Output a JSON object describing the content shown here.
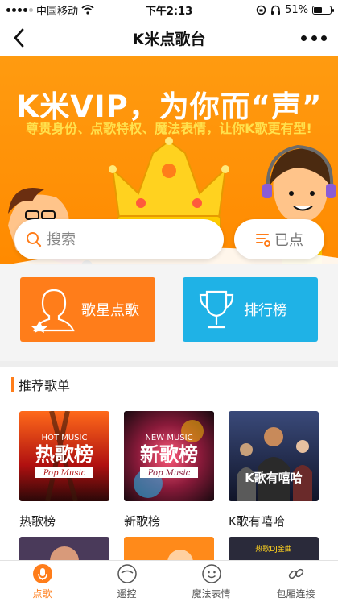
{
  "status_bar": {
    "carrier": "中国移动",
    "time": "下午2:13",
    "battery": "51%",
    "battery_level": 0.51
  },
  "nav": {
    "title": "K米点歌台"
  },
  "banner": {
    "headline": "K米VIP，为你而“声”",
    "subline": "尊贵身份、点歌特权、魔法表情，让你K歌更有型!"
  },
  "search": {
    "placeholder": "搜索",
    "played_label": "已点"
  },
  "features": [
    {
      "label": "歌星点歌",
      "icon": "singer-icon",
      "color": "#ff7d1a"
    },
    {
      "label": "排行榜",
      "icon": "trophy-icon",
      "color": "#1fb2e6"
    }
  ],
  "recommend": {
    "heading": "推荐歌单",
    "playlists": [
      {
        "title": "热歌榜",
        "art_top": "HOT MUSIC",
        "art_main": "热歌榜",
        "art_sub": "Pop Music"
      },
      {
        "title": "新歌榜",
        "art_top": "NEW MUSIC",
        "art_main": "新歌榜",
        "art_sub": "Pop Music"
      },
      {
        "title": "K歌有嘻哈",
        "art_main": "K歌有嘻哈"
      }
    ],
    "partial_tiles": [
      {
        "art_text": ""
      },
      {
        "art_text": ""
      },
      {
        "art_text": "热歌DJ金曲"
      }
    ]
  },
  "tabs": [
    {
      "label": "点歌",
      "icon": "microphone-icon",
      "active": true
    },
    {
      "label": "遥控",
      "icon": "remote-icon",
      "active": false
    },
    {
      "label": "魔法表情",
      "icon": "smile-icon",
      "active": false
    },
    {
      "label": "包厢连接",
      "icon": "link-icon",
      "active": false
    }
  ],
  "colors": {
    "accent": "#ff7d1a",
    "banner": "#ff9b10",
    "rank": "#1fb2e6"
  }
}
